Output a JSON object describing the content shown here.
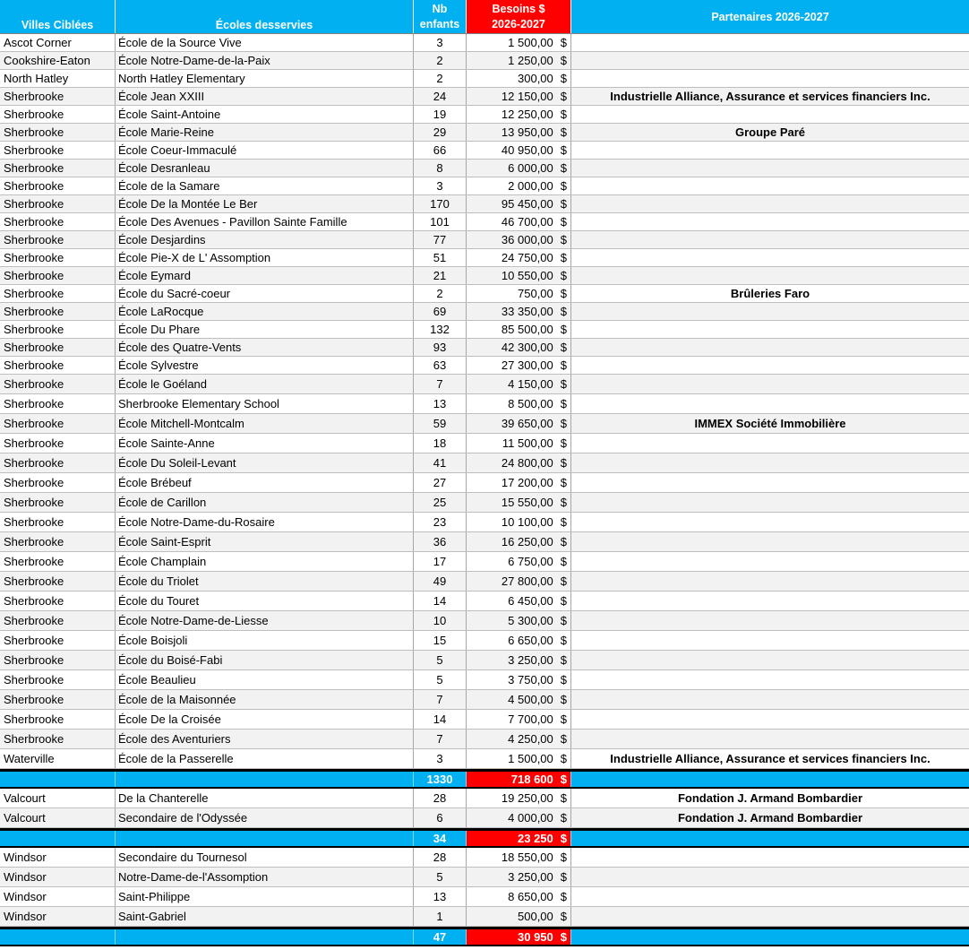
{
  "header": {
    "ville": "Villes Ciblées",
    "ecole": "Écoles desservies",
    "nb_line1": "Nb",
    "nb_line2": "enfants",
    "besoins_line1": "Besoins $",
    "besoins_line2": "2026-2027",
    "partenaires": "Partenaires 2026-2027"
  },
  "currency": "$",
  "groups": [
    {
      "rows": [
        {
          "ville": "Ascot Corner",
          "ecole": "École de la Source Vive",
          "nb": "3",
          "besoins": "1 500,00",
          "partenaire": ""
        },
        {
          "ville": "Cookshire-Eaton",
          "ecole": "École Notre-Dame-de-la-Paix",
          "nb": "2",
          "besoins": "1 250,00",
          "partenaire": ""
        },
        {
          "ville": "North Hatley",
          "ecole": "North Hatley Elementary",
          "nb": "2",
          "besoins": "300,00",
          "partenaire": ""
        },
        {
          "ville": "Sherbrooke",
          "ecole": "École Jean XXIII",
          "nb": "24",
          "besoins": "12 150,00",
          "partenaire": "Industrielle Alliance, Assurance et services financiers Inc."
        },
        {
          "ville": "Sherbrooke",
          "ecole": "École Saint-Antoine",
          "nb": "19",
          "besoins": "12 250,00",
          "partenaire": ""
        },
        {
          "ville": "Sherbrooke",
          "ecole": "École Marie-Reine",
          "nb": "29",
          "besoins": "13 950,00",
          "partenaire": "Groupe Paré"
        },
        {
          "ville": "Sherbrooke",
          "ecole": "École Coeur-Immaculé",
          "nb": "66",
          "besoins": "40 950,00",
          "partenaire": ""
        },
        {
          "ville": "Sherbrooke",
          "ecole": "École Desranleau",
          "nb": "8",
          "besoins": "6 000,00",
          "partenaire": ""
        },
        {
          "ville": "Sherbrooke",
          "ecole": "École de la Samare",
          "nb": "3",
          "besoins": "2 000,00",
          "partenaire": ""
        },
        {
          "ville": "Sherbrooke",
          "ecole": "École De la Montée Le Ber",
          "nb": "170",
          "besoins": "95 450,00",
          "partenaire": ""
        },
        {
          "ville": "Sherbrooke",
          "ecole": "École Des Avenues - Pavillon Sainte Famille",
          "nb": "101",
          "besoins": "46 700,00",
          "partenaire": ""
        },
        {
          "ville": "Sherbrooke",
          "ecole": "École Desjardins",
          "nb": "77",
          "besoins": "36 000,00",
          "partenaire": ""
        },
        {
          "ville": "Sherbrooke",
          "ecole": "École Pie-X de L' Assomption",
          "nb": "51",
          "besoins": "24 750,00",
          "partenaire": ""
        },
        {
          "ville": "Sherbrooke",
          "ecole": "École Eymard",
          "nb": "21",
          "besoins": "10 550,00",
          "partenaire": ""
        },
        {
          "ville": "Sherbrooke",
          "ecole": "École du Sacré-coeur",
          "nb": "2",
          "besoins": "750,00",
          "partenaire": "Brûleries Faro"
        },
        {
          "ville": "Sherbrooke",
          "ecole": "École LaRocque",
          "nb": "69",
          "besoins": "33 350,00",
          "partenaire": ""
        },
        {
          "ville": "Sherbrooke",
          "ecole": "École Du Phare",
          "nb": "132",
          "besoins": "85 500,00",
          "partenaire": ""
        },
        {
          "ville": "Sherbrooke",
          "ecole": "École des Quatre-Vents",
          "nb": "93",
          "besoins": "42 300,00",
          "partenaire": ""
        },
        {
          "ville": "Sherbrooke",
          "ecole": "École Sylvestre",
          "nb": "63",
          "besoins": "27 300,00",
          "partenaire": ""
        },
        {
          "ville": "Sherbrooke",
          "ecole": "École le Goéland",
          "nb": "7",
          "besoins": "4 150,00",
          "partenaire": ""
        },
        {
          "ville": "Sherbrooke",
          "ecole": "Sherbrooke Elementary School",
          "nb": "13",
          "besoins": "8 500,00",
          "partenaire": ""
        },
        {
          "ville": "Sherbrooke",
          "ecole": "École Mitchell-Montcalm",
          "nb": "59",
          "besoins": "39 650,00",
          "partenaire": "IMMEX Société Immobilière"
        },
        {
          "ville": "Sherbrooke",
          "ecole": "École Sainte-Anne",
          "nb": "18",
          "besoins": "11 500,00",
          "partenaire": ""
        },
        {
          "ville": "Sherbrooke",
          "ecole": "École Du Soleil-Levant",
          "nb": "41",
          "besoins": "24 800,00",
          "partenaire": ""
        },
        {
          "ville": "Sherbrooke",
          "ecole": "École Brébeuf",
          "nb": "27",
          "besoins": "17 200,00",
          "partenaire": ""
        },
        {
          "ville": "Sherbrooke",
          "ecole": "École de Carillon",
          "nb": "25",
          "besoins": "15 550,00",
          "partenaire": ""
        },
        {
          "ville": "Sherbrooke",
          "ecole": "École Notre-Dame-du-Rosaire",
          "nb": "23",
          "besoins": "10 100,00",
          "partenaire": ""
        },
        {
          "ville": "Sherbrooke",
          "ecole": "École Saint-Esprit",
          "nb": "36",
          "besoins": "16 250,00",
          "partenaire": ""
        },
        {
          "ville": "Sherbrooke",
          "ecole": "École Champlain",
          "nb": "17",
          "besoins": "6 750,00",
          "partenaire": ""
        },
        {
          "ville": "Sherbrooke",
          "ecole": "École du Triolet",
          "nb": "49",
          "besoins": "27 800,00",
          "partenaire": ""
        },
        {
          "ville": "Sherbrooke",
          "ecole": "École du Touret",
          "nb": "14",
          "besoins": "6 450,00",
          "partenaire": ""
        },
        {
          "ville": "Sherbrooke",
          "ecole": "École Notre-Dame-de-Liesse",
          "nb": "10",
          "besoins": "5 300,00",
          "partenaire": ""
        },
        {
          "ville": "Sherbrooke",
          "ecole": "École Boisjoli",
          "nb": "15",
          "besoins": "6 650,00",
          "partenaire": ""
        },
        {
          "ville": "Sherbrooke",
          "ecole": "École du Boisé-Fabi",
          "nb": "5",
          "besoins": "3 250,00",
          "partenaire": ""
        },
        {
          "ville": "Sherbrooke",
          "ecole": "École Beaulieu",
          "nb": "5",
          "besoins": "3 750,00",
          "partenaire": ""
        },
        {
          "ville": "Sherbrooke",
          "ecole": "École de la Maisonnée",
          "nb": "7",
          "besoins": "4 500,00",
          "partenaire": ""
        },
        {
          "ville": "Sherbrooke",
          "ecole": "École De la Croisée",
          "nb": "14",
          "besoins": "7 700,00",
          "partenaire": ""
        },
        {
          "ville": "Sherbrooke",
          "ecole": "École des Aventuriers",
          "nb": "7",
          "besoins": "4 250,00",
          "partenaire": ""
        },
        {
          "ville": "Waterville",
          "ecole": "École de la Passerelle",
          "nb": "3",
          "besoins": "1 500,00",
          "partenaire": "Industrielle Alliance, Assurance et services financiers Inc."
        }
      ],
      "total": {
        "nb": "1330",
        "besoins": "718 600"
      }
    },
    {
      "rows": [
        {
          "ville": "Valcourt",
          "ecole": "De la Chanterelle",
          "nb": "28",
          "besoins": "19 250,00",
          "partenaire": "Fondation J. Armand Bombardier"
        },
        {
          "ville": "Valcourt",
          "ecole": "Secondaire de l'Odyssée",
          "nb": "6",
          "besoins": "4 000,00",
          "partenaire": "Fondation J. Armand Bombardier"
        }
      ],
      "total": {
        "nb": "34",
        "besoins": "23 250"
      }
    },
    {
      "rows": [
        {
          "ville": "Windsor",
          "ecole": "Secondaire du Tournesol",
          "nb": "28",
          "besoins": "18 550,00",
          "partenaire": ""
        },
        {
          "ville": "Windsor",
          "ecole": "Notre-Dame-de-l'Assomption",
          "nb": "5",
          "besoins": "3 250,00",
          "partenaire": ""
        },
        {
          "ville": "Windsor",
          "ecole": "Saint-Philippe",
          "nb": "13",
          "besoins": "8 650,00",
          "partenaire": ""
        },
        {
          "ville": "Windsor",
          "ecole": "Saint-Gabriel",
          "nb": "1",
          "besoins": "500,00",
          "partenaire": ""
        }
      ],
      "total": {
        "nb": "47",
        "besoins": "30 950"
      }
    }
  ]
}
